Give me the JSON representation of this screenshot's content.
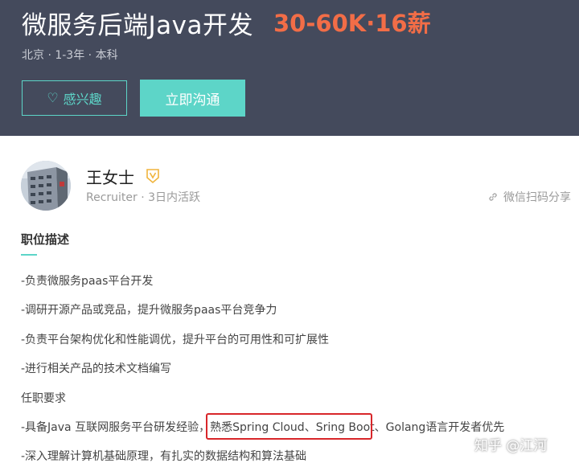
{
  "job": {
    "title": "微服务后端Java开发",
    "salary": "30-60K·16薪",
    "meta": "北京 · 1-3年 · 本科"
  },
  "actions": {
    "interest_label": "感兴趣",
    "chat_label": "立即沟通"
  },
  "recruiter": {
    "name": "王女士",
    "subtitle": "Recruiter · 3日内活跃",
    "share_label": "微信扫码分享"
  },
  "description": {
    "title": "职位描述",
    "lines": [
      "-负责微服务paas平台开发",
      "-调研开源产品或竞品，提升微服务paas平台竞争力",
      "-负责平台架构优化和性能调优，提升平台的可用性和可扩展性",
      "-进行相关产品的技术文档编写",
      "任职要求",
      "-具备Java 互联网服务平台研发经验，熟悉Spring Cloud、Sring Boot、Golang语言开发者优先",
      "-深入理解计算机基础原理，有扎实的数据结构和算法基础"
    ]
  },
  "watermark": "知乎 @江河",
  "colors": {
    "header_bg": "#444a5c",
    "accent": "#5dd5c8",
    "salary": "#f26d47",
    "highlight_box": "#d8262a"
  }
}
